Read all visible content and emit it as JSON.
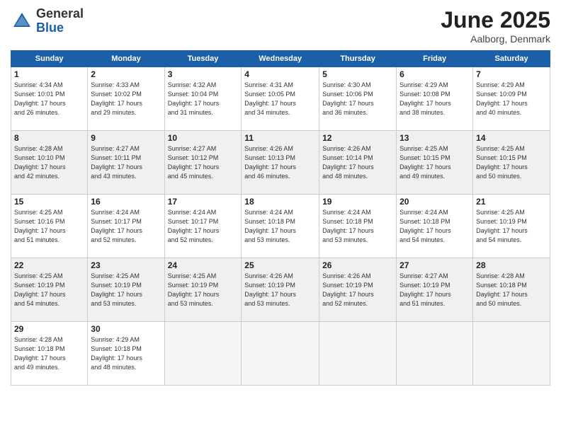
{
  "header": {
    "logo_general": "General",
    "logo_blue": "Blue",
    "month_title": "June 2025",
    "location": "Aalborg, Denmark"
  },
  "days_of_week": [
    "Sunday",
    "Monday",
    "Tuesday",
    "Wednesday",
    "Thursday",
    "Friday",
    "Saturday"
  ],
  "weeks": [
    [
      {
        "day": "1",
        "info": "Sunrise: 4:34 AM\nSunset: 10:01 PM\nDaylight: 17 hours\nand 26 minutes."
      },
      {
        "day": "2",
        "info": "Sunrise: 4:33 AM\nSunset: 10:02 PM\nDaylight: 17 hours\nand 29 minutes."
      },
      {
        "day": "3",
        "info": "Sunrise: 4:32 AM\nSunset: 10:04 PM\nDaylight: 17 hours\nand 31 minutes."
      },
      {
        "day": "4",
        "info": "Sunrise: 4:31 AM\nSunset: 10:05 PM\nDaylight: 17 hours\nand 34 minutes."
      },
      {
        "day": "5",
        "info": "Sunrise: 4:30 AM\nSunset: 10:06 PM\nDaylight: 17 hours\nand 36 minutes."
      },
      {
        "day": "6",
        "info": "Sunrise: 4:29 AM\nSunset: 10:08 PM\nDaylight: 17 hours\nand 38 minutes."
      },
      {
        "day": "7",
        "info": "Sunrise: 4:29 AM\nSunset: 10:09 PM\nDaylight: 17 hours\nand 40 minutes."
      }
    ],
    [
      {
        "day": "8",
        "info": "Sunrise: 4:28 AM\nSunset: 10:10 PM\nDaylight: 17 hours\nand 42 minutes."
      },
      {
        "day": "9",
        "info": "Sunrise: 4:27 AM\nSunset: 10:11 PM\nDaylight: 17 hours\nand 43 minutes."
      },
      {
        "day": "10",
        "info": "Sunrise: 4:27 AM\nSunset: 10:12 PM\nDaylight: 17 hours\nand 45 minutes."
      },
      {
        "day": "11",
        "info": "Sunrise: 4:26 AM\nSunset: 10:13 PM\nDaylight: 17 hours\nand 46 minutes."
      },
      {
        "day": "12",
        "info": "Sunrise: 4:26 AM\nSunset: 10:14 PM\nDaylight: 17 hours\nand 48 minutes."
      },
      {
        "day": "13",
        "info": "Sunrise: 4:25 AM\nSunset: 10:15 PM\nDaylight: 17 hours\nand 49 minutes."
      },
      {
        "day": "14",
        "info": "Sunrise: 4:25 AM\nSunset: 10:15 PM\nDaylight: 17 hours\nand 50 minutes."
      }
    ],
    [
      {
        "day": "15",
        "info": "Sunrise: 4:25 AM\nSunset: 10:16 PM\nDaylight: 17 hours\nand 51 minutes."
      },
      {
        "day": "16",
        "info": "Sunrise: 4:24 AM\nSunset: 10:17 PM\nDaylight: 17 hours\nand 52 minutes."
      },
      {
        "day": "17",
        "info": "Sunrise: 4:24 AM\nSunset: 10:17 PM\nDaylight: 17 hours\nand 52 minutes."
      },
      {
        "day": "18",
        "info": "Sunrise: 4:24 AM\nSunset: 10:18 PM\nDaylight: 17 hours\nand 53 minutes."
      },
      {
        "day": "19",
        "info": "Sunrise: 4:24 AM\nSunset: 10:18 PM\nDaylight: 17 hours\nand 53 minutes."
      },
      {
        "day": "20",
        "info": "Sunrise: 4:24 AM\nSunset: 10:18 PM\nDaylight: 17 hours\nand 54 minutes."
      },
      {
        "day": "21",
        "info": "Sunrise: 4:25 AM\nSunset: 10:19 PM\nDaylight: 17 hours\nand 54 minutes."
      }
    ],
    [
      {
        "day": "22",
        "info": "Sunrise: 4:25 AM\nSunset: 10:19 PM\nDaylight: 17 hours\nand 54 minutes."
      },
      {
        "day": "23",
        "info": "Sunrise: 4:25 AM\nSunset: 10:19 PM\nDaylight: 17 hours\nand 53 minutes."
      },
      {
        "day": "24",
        "info": "Sunrise: 4:25 AM\nSunset: 10:19 PM\nDaylight: 17 hours\nand 53 minutes."
      },
      {
        "day": "25",
        "info": "Sunrise: 4:26 AM\nSunset: 10:19 PM\nDaylight: 17 hours\nand 53 minutes."
      },
      {
        "day": "26",
        "info": "Sunrise: 4:26 AM\nSunset: 10:19 PM\nDaylight: 17 hours\nand 52 minutes."
      },
      {
        "day": "27",
        "info": "Sunrise: 4:27 AM\nSunset: 10:19 PM\nDaylight: 17 hours\nand 51 minutes."
      },
      {
        "day": "28",
        "info": "Sunrise: 4:28 AM\nSunset: 10:18 PM\nDaylight: 17 hours\nand 50 minutes."
      }
    ],
    [
      {
        "day": "29",
        "info": "Sunrise: 4:28 AM\nSunset: 10:18 PM\nDaylight: 17 hours\nand 49 minutes."
      },
      {
        "day": "30",
        "info": "Sunrise: 4:29 AM\nSunset: 10:18 PM\nDaylight: 17 hours\nand 48 minutes."
      },
      {
        "day": "",
        "info": ""
      },
      {
        "day": "",
        "info": ""
      },
      {
        "day": "",
        "info": ""
      },
      {
        "day": "",
        "info": ""
      },
      {
        "day": "",
        "info": ""
      }
    ]
  ]
}
